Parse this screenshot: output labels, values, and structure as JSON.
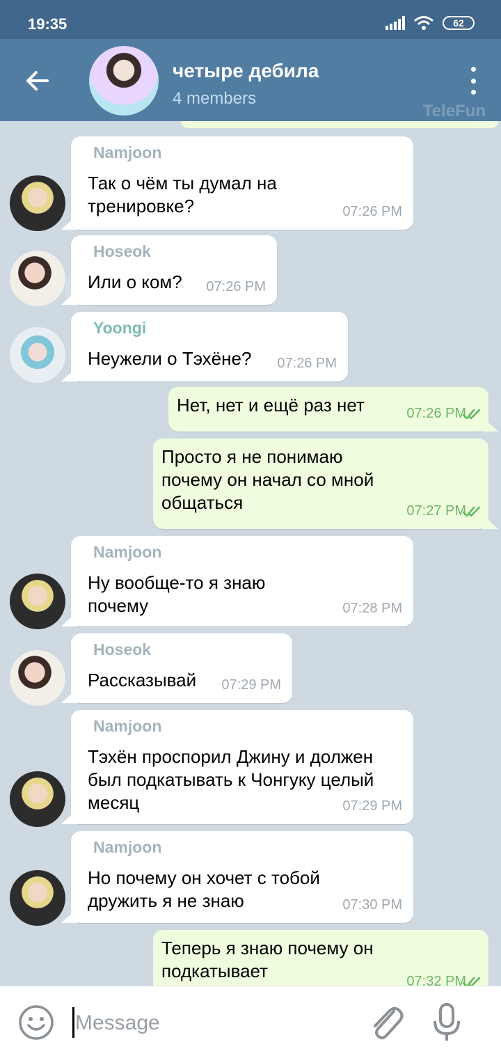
{
  "status": {
    "time": "19:35",
    "battery": "62"
  },
  "header": {
    "title": "четыре дебила",
    "subtitle": "4 members",
    "watermark": "TeleFun"
  },
  "colors": {
    "namjoon": "#a4b4bb",
    "hoseok": "#a4b4bb",
    "yoongi": "#7fbab0",
    "outgoing_bubble": "#effdde",
    "header": "#517da2"
  },
  "messages": [
    {
      "sender": "Namjoon",
      "text": "Так о чём ты думал на тренировке?",
      "time": "07:26 PM",
      "direction": "in"
    },
    {
      "sender": "Hoseok",
      "text": "Или о ком?",
      "time": "07:26 PM",
      "direction": "in"
    },
    {
      "sender": "Yoongi",
      "text": "Неужели о Тэхёне?",
      "time": "07:26 PM",
      "direction": "in"
    },
    {
      "text": "Нет, нет и ещё раз нет",
      "time": "07:26 PM",
      "direction": "out"
    },
    {
      "text": "Просто я не понимаю почему он начал со мной общаться",
      "time": "07:27 PM",
      "direction": "out"
    },
    {
      "sender": "Namjoon",
      "text": "Ну вообще-то я знаю почему",
      "time": "07:28 PM",
      "direction": "in"
    },
    {
      "sender": "Hoseok",
      "text": "Рассказывай",
      "time": "07:29 PM",
      "direction": "in"
    },
    {
      "sender": "Namjoon",
      "text": "Тэхён проспорил Джину и должен был подкатывать к Чонгуку целый месяц",
      "time": "07:29 PM",
      "direction": "in"
    },
    {
      "sender": "Namjoon",
      "text": "Но почему он хочет с тобой дружить я не знаю",
      "time": "07:30 PM",
      "direction": "in"
    },
    {
      "text": "Теперь я знаю почему он подкатывает",
      "time": "07:32 PM",
      "direction": "out"
    }
  ],
  "input": {
    "placeholder": "Message"
  },
  "icons": [
    "back-arrow-icon",
    "more-vert-icon",
    "emoji-icon",
    "paperclip-icon",
    "mic-icon",
    "double-check-icon"
  ]
}
